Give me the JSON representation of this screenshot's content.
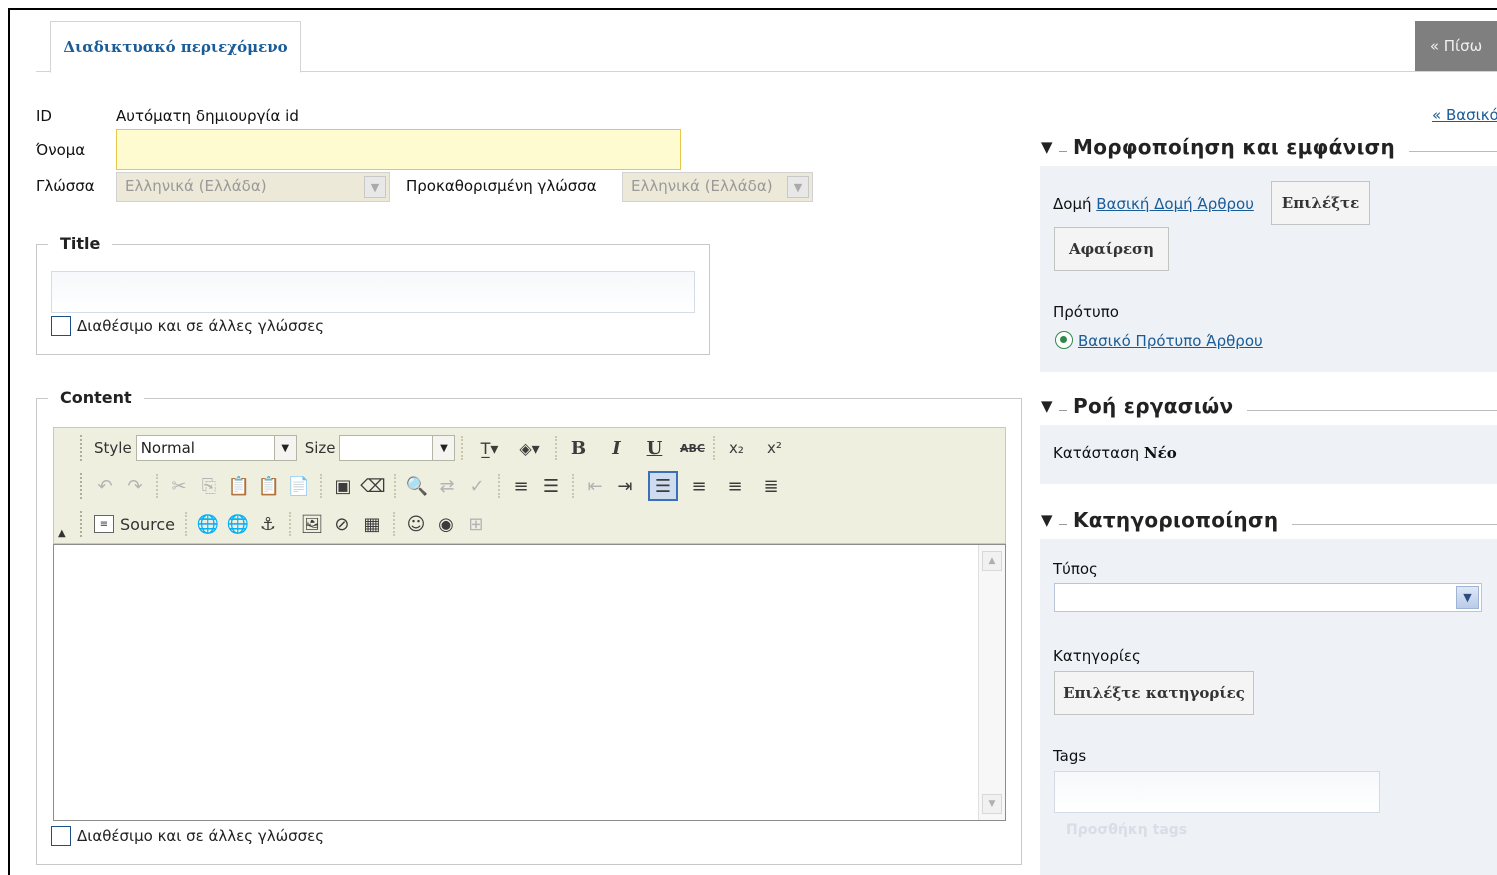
{
  "header": {
    "tab_label": "Διαδικτυακό περιεχόμενο",
    "back_label": "« Πίσω"
  },
  "form": {
    "id_label": "ID",
    "id_value": "Αυτόματη δημιουργία id",
    "name_label": "Όνομα",
    "name_value": "",
    "language_label": "Γλώσσα",
    "language_value": "Ελληνικά (Ελλάδα)",
    "default_language_label": "Προκαθορισμένη γλώσσα",
    "default_language_value": "Ελληνικά (Ελλάδα)"
  },
  "title_section": {
    "legend": "Title",
    "value": "",
    "available_label": "Διαθέσιμο και σε άλλες γλώσσες"
  },
  "content_section": {
    "legend": "Content",
    "available_label": "Διαθέσιμο και σε άλλες γλώσσες",
    "toolbar": {
      "style_label": "Style",
      "style_value": "Normal",
      "size_label": "Size",
      "size_value": "",
      "bold": "B",
      "italic": "I",
      "underline": "U",
      "strike": "ABC",
      "subscript": "x₂",
      "superscript": "x²",
      "source_label": "Source"
    },
    "body": ""
  },
  "sidebar": {
    "basic_link": "« Βασικό",
    "formatting": {
      "title": "Μορφοποίηση και εμφάνιση",
      "structure_label": "Δομή",
      "structure_value": "Βασική Δομή Άρθρου",
      "select_button": "Επιλέξτε",
      "remove_button": "Αφαίρεση",
      "template_label": "Πρότυπο",
      "template_value": "Βασικό Πρότυπο Άρθρου"
    },
    "workflow": {
      "title": "Ροή εργασιών",
      "status_label": "Κατάσταση",
      "status_value": "Νέο"
    },
    "categorization": {
      "title": "Κατηγοριοποίηση",
      "type_label": "Τύπος",
      "type_value": "",
      "categories_label": "Κατηγορίες",
      "select_categories_button": "Επιλέξτε κατηγορίες",
      "tags_label": "Tags",
      "tags_value": "",
      "add_tags_button": "Προσθήκη tags"
    }
  },
  "colors": {
    "link": "#1a5c97",
    "back_button": "#7f7f7f",
    "highlight_input": "#fefbd0",
    "panel_bg": "#eef2f7",
    "toolbar_bg": "#efefdf"
  }
}
